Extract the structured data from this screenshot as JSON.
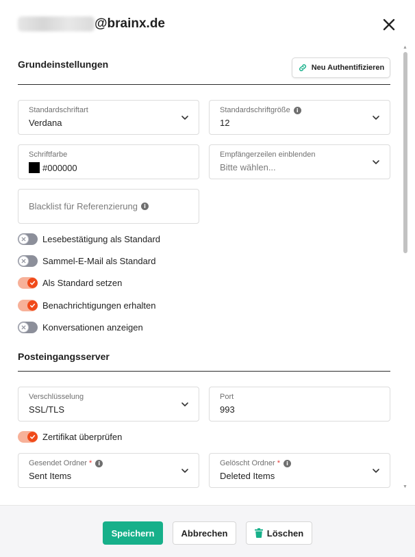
{
  "header": {
    "email_domain": "@brainx.de",
    "close_icon": "close-icon"
  },
  "sections": {
    "general": {
      "title": "Grundeinstellungen",
      "auth_button": "Neu Authentifizieren",
      "auth_icon": "link-icon"
    },
    "inbox_server": {
      "title": "Posteingangsserver"
    }
  },
  "fields": {
    "default_font": {
      "label": "Standardschriftart",
      "value": "Verdana"
    },
    "default_font_size": {
      "label": "Standardschriftgröße",
      "value": "12"
    },
    "font_color": {
      "label": "Schriftfarbe",
      "value": "#000000",
      "swatch_color": "#000000"
    },
    "recipient_lines": {
      "label": "Empfängerzeilen einblenden",
      "placeholder": "Bitte wählen..."
    },
    "blacklist": {
      "placeholder": "Blacklist für Referenzierung"
    },
    "encryption": {
      "label": "Verschlüsselung",
      "value": "SSL/TLS"
    },
    "port": {
      "label": "Port",
      "value": "993"
    },
    "sent_folder": {
      "label": "Gesendet Ordner",
      "required": "*",
      "value": "Sent Items"
    },
    "deleted_folder": {
      "label": "Gelöscht Ordner",
      "required": "*",
      "value": "Deleted Items"
    }
  },
  "toggles": {
    "read_receipt": {
      "label": "Lesebestätigung als Standard",
      "on": false
    },
    "bulk_email": {
      "label": "Sammel-E-Mail als Standard",
      "on": false
    },
    "set_default": {
      "label": "Als Standard setzen",
      "on": true
    },
    "notifications": {
      "label": "Benachrichtigungen erhalten",
      "on": true
    },
    "conversations": {
      "label": "Konversationen anzeigen",
      "on": false
    },
    "verify_cert": {
      "label": "Zertifikat überprüfen",
      "on": true
    }
  },
  "footer": {
    "save": "Speichern",
    "cancel": "Abbrechen",
    "delete": "Löschen",
    "delete_icon": "trash-icon"
  },
  "colors": {
    "primary": "#17b08a",
    "toggle_on": "#f04a1a",
    "toggle_on_track": "#f7b199",
    "toggle_off_track": "#8c8f9a"
  }
}
